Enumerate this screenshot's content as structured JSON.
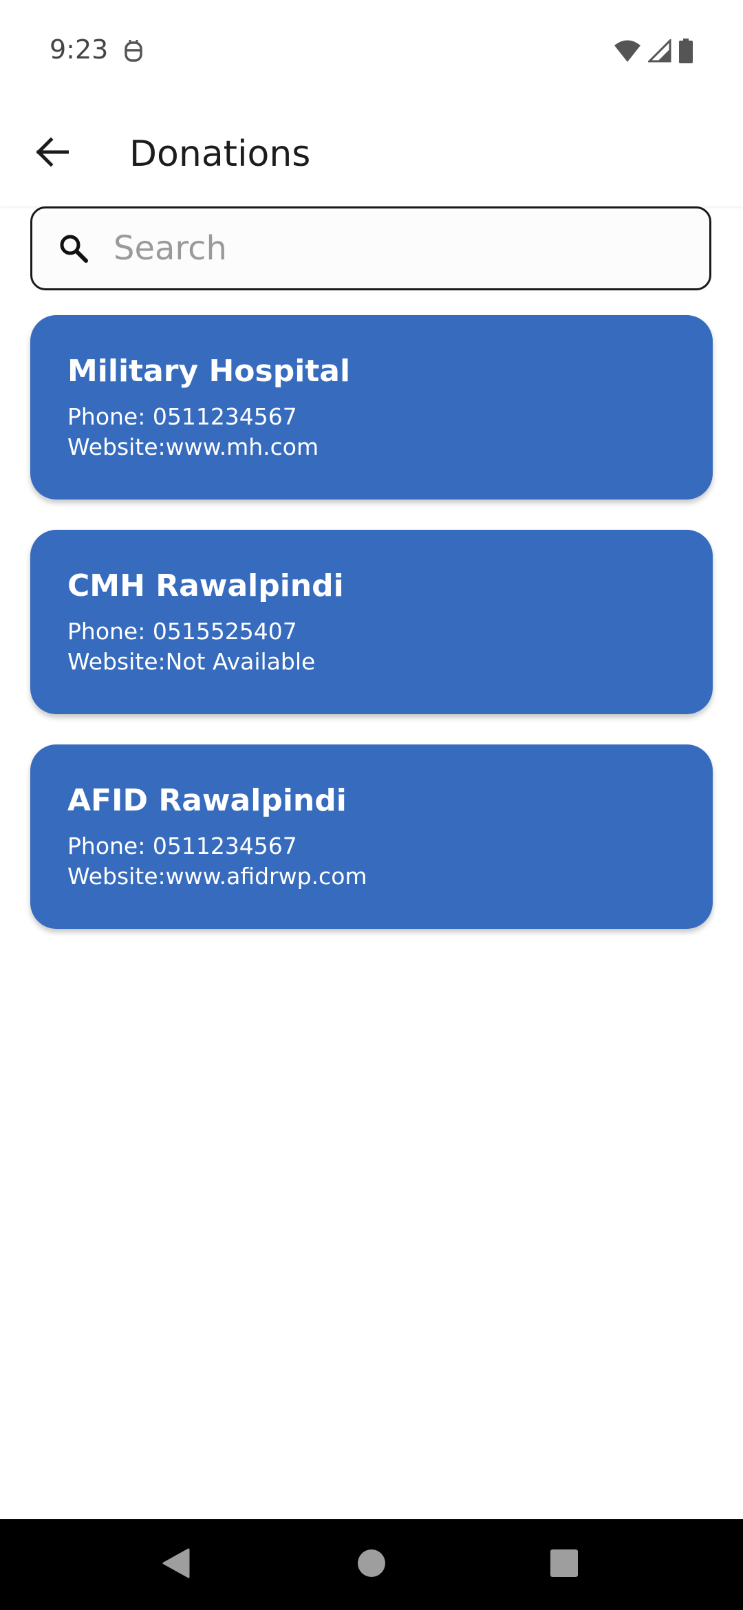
{
  "status_bar": {
    "time": "9:23",
    "icons": [
      "notification-icon",
      "wifi-icon",
      "cell-signal-icon",
      "battery-icon"
    ]
  },
  "app_bar": {
    "title": "Donations",
    "back_icon": "arrow-back-icon"
  },
  "search": {
    "placeholder": "Search",
    "value": "",
    "icon": "search-icon"
  },
  "hospitals": [
    {
      "name": "Military Hospital",
      "phone": "Phone: 0511234567",
      "website": "Website:www.mh.com"
    },
    {
      "name": "CMH Rawalpindi",
      "phone": "Phone: 0515525407",
      "website": "Website:Not Available"
    },
    {
      "name": "AFID Rawalpindi",
      "phone": "Phone: 0511234567",
      "website": "Website:www.afidrwp.com"
    }
  ],
  "nav_bar": {
    "buttons": [
      "back-triangle-icon",
      "home-circle-icon",
      "recents-square-icon"
    ]
  },
  "colors": {
    "card_background": "#366bbe",
    "card_text": "#ffffff",
    "nav_bar": "#000000"
  }
}
